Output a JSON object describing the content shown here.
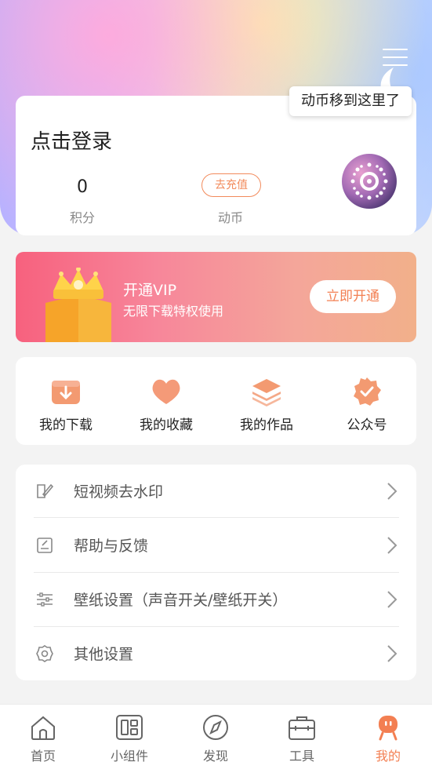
{
  "colors": {
    "accent": "#f37f52",
    "vip_gradient_start": "#f7617e",
    "vip_gradient_end": "#f2b08a",
    "background": "#f3f3f3"
  },
  "header": {
    "menu_icon": "hamburger-icon",
    "tooltip": "动币移到这里了"
  },
  "profile": {
    "login_prompt": "点击登录",
    "points_value": "0",
    "points_label": "积分",
    "recharge_label": "去充值",
    "coins_label": "动币"
  },
  "vip": {
    "title": "开通VIP",
    "subtitle": "无限下载特权使用",
    "button": "立即开通",
    "icon": "crown-icon"
  },
  "shortcuts": [
    {
      "label": "我的下载",
      "icon": "download-icon"
    },
    {
      "label": "我的收藏",
      "icon": "heart-icon"
    },
    {
      "label": "我的作品",
      "icon": "layers-icon"
    },
    {
      "label": "公众号",
      "icon": "badge-check-icon"
    }
  ],
  "menu": [
    {
      "label": "短视频去水印",
      "icon": "erase-watermark-icon"
    },
    {
      "label": "帮助与反馈",
      "icon": "feedback-icon"
    },
    {
      "label": "壁纸设置（声音开关/壁纸开关）",
      "icon": "sliders-icon"
    },
    {
      "label": "其他设置",
      "icon": "gear-icon"
    }
  ],
  "tabbar": [
    {
      "label": "首页",
      "icon": "home-icon",
      "active": false
    },
    {
      "label": "小组件",
      "icon": "widget-icon",
      "active": false
    },
    {
      "label": "发现",
      "icon": "compass-icon",
      "active": false
    },
    {
      "label": "工具",
      "icon": "toolbox-icon",
      "active": false
    },
    {
      "label": "我的",
      "icon": "profile-mascot-icon",
      "active": true
    }
  ]
}
